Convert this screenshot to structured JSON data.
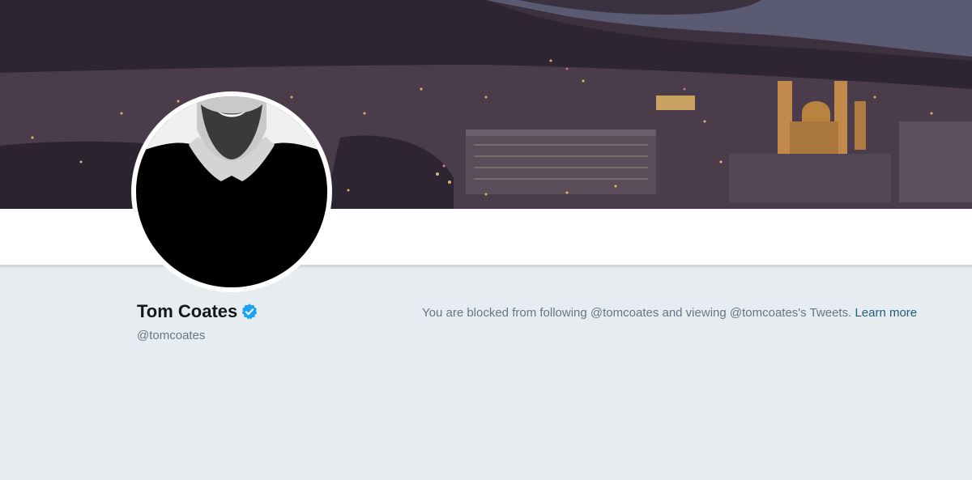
{
  "profile": {
    "name": "Tom Coates",
    "handle": "@tomcoates",
    "verified": true
  },
  "blocked": {
    "message": "You are blocked from following @tomcoates and viewing @tomcoates's Tweets.",
    "learn_more": "Learn more"
  },
  "colors": {
    "page_background": "#e6ecf0",
    "verified_badge": "#1da1f2",
    "link": "#1b5f7a",
    "muted_text": "#657786"
  },
  "icons": {
    "verified": "verified-badge-icon"
  }
}
